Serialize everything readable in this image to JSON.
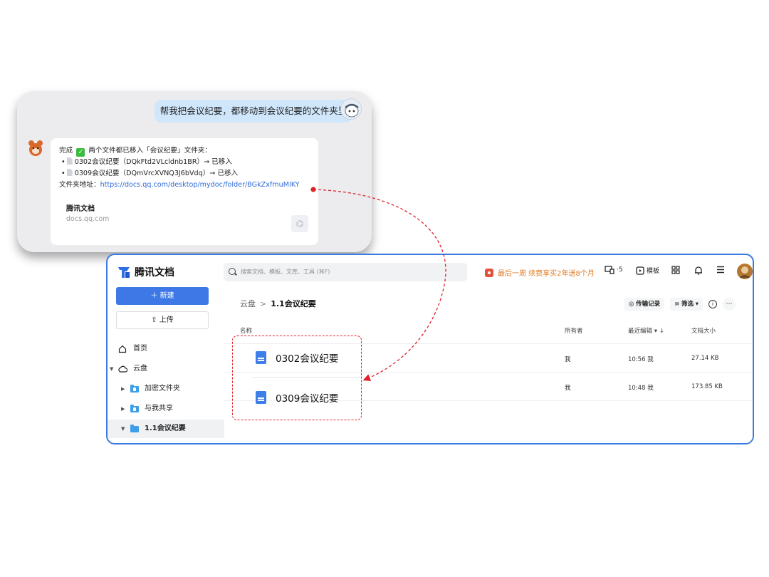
{
  "chat": {
    "user_message": "帮我把会议纪要，都移动到会议纪要的文件夹里",
    "reply": {
      "done_prefix": "完成",
      "done_suffix": "两个文件都已移入「会议纪要」文件夹：",
      "items": [
        "0302会议纪要（DQkFtd2VLcldnb1BR）→ 已移入",
        "0309会议纪要（DQmVrcXVNQ3J6bVdq）→ 已移入"
      ],
      "folder_label": "文件夹地址：",
      "folder_url": "https://docs.qq.com/desktop/mydoc/folder/BGkZxfmuMIKY",
      "preview_title": "腾讯文档",
      "preview_domain": "docs.qq.com"
    }
  },
  "app": {
    "brand": "腾讯文档",
    "search_placeholder": "搜索文档、模板、文库、工具 (⌘F)",
    "promo": "最后一周 续费享买2年送8个月",
    "device_count": "·5",
    "template_label": "模板",
    "new_button": "新建",
    "upload_button": "上传",
    "nav": {
      "home": "首页",
      "cloud": "云盘",
      "encrypted": "加密文件夹",
      "shared": "与我共享",
      "current": "1.1会议纪要"
    },
    "breadcrumb": {
      "root": "云盘",
      "sep": ">",
      "current": "1.1会议纪要"
    },
    "actions": {
      "transfer": "传输记录",
      "filter": "筛选"
    },
    "columns": {
      "name": "名称",
      "owner": "所有者",
      "edited": "最近编辑",
      "size": "文档大小"
    },
    "files": [
      {
        "name": "0302会议纪要",
        "owner": "我",
        "edited": "10:56 我",
        "size": "27.14 KB"
      },
      {
        "name": "0309会议纪要",
        "owner": "我",
        "edited": "10:48 我",
        "size": "173.85 KB"
      }
    ]
  },
  "colors": {
    "accent": "#3d78e6",
    "annotation": "#e0232b",
    "promo": "#e17b25",
    "link": "#2f6bd8"
  }
}
